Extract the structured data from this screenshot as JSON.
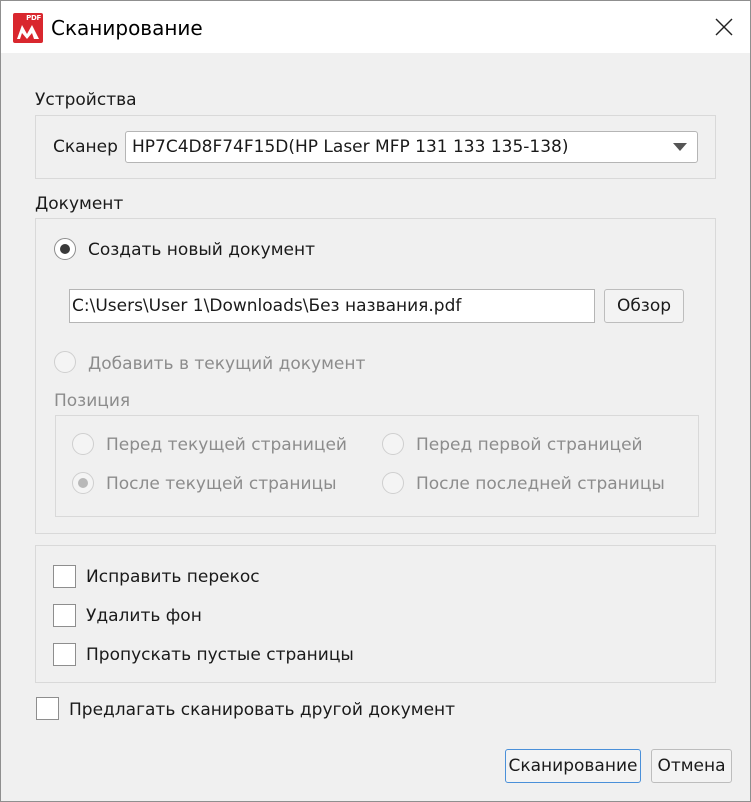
{
  "window": {
    "title": "Сканирование",
    "app_icon_tag": "PDF"
  },
  "devices": {
    "section_label": "Устройства",
    "scanner_label": "Сканер",
    "scanner_value": "HP7C4D8F74F15D(HP Laser MFP 131 133 135-138)"
  },
  "document": {
    "section_label": "Документ",
    "create_new_label": "Создать новый документ",
    "create_new_checked": true,
    "file_path": "C:\\Users\\User 1\\Downloads\\Без названия.pdf",
    "browse_label": "Обзор",
    "add_to_current_label": "Добавить в текущий документ",
    "add_to_current_checked": false,
    "position": {
      "label": "Позиция",
      "options": [
        {
          "label": "Перед текущей страницей",
          "checked": false
        },
        {
          "label": "Перед первой страницей",
          "checked": false
        },
        {
          "label": "После текущей страницы",
          "checked": true
        },
        {
          "label": "После последней страницы",
          "checked": false
        }
      ]
    }
  },
  "options": {
    "deskew_label": "Исправить перекос",
    "remove_bg_label": "Удалить фон",
    "skip_blank_label": "Пропускать пустые страницы"
  },
  "offer_another_label": "Предлагать сканировать другой документ",
  "buttons": {
    "scan_label": "Сканирование",
    "cancel_label": "Отмена"
  }
}
